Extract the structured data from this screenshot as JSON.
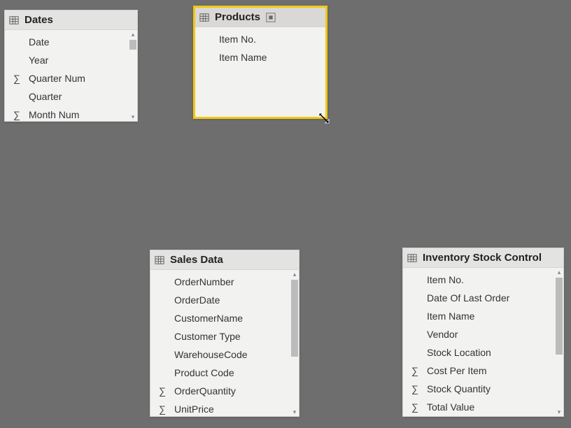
{
  "tables": {
    "dates": {
      "title": "Dates",
      "fields": [
        {
          "name": "Date",
          "sigma": false
        },
        {
          "name": "Year",
          "sigma": false
        },
        {
          "name": "Quarter Num",
          "sigma": true
        },
        {
          "name": "Quarter",
          "sigma": false
        },
        {
          "name": "Month Num",
          "sigma": true
        }
      ]
    },
    "products": {
      "title": "Products",
      "fields": [
        {
          "name": "Item No.",
          "sigma": false
        },
        {
          "name": "Item Name",
          "sigma": false
        }
      ]
    },
    "sales": {
      "title": "Sales Data",
      "fields": [
        {
          "name": "OrderNumber",
          "sigma": false
        },
        {
          "name": "OrderDate",
          "sigma": false
        },
        {
          "name": "CustomerName",
          "sigma": false
        },
        {
          "name": "Customer Type",
          "sigma": false
        },
        {
          "name": "WarehouseCode",
          "sigma": false
        },
        {
          "name": "Product Code",
          "sigma": false
        },
        {
          "name": "OrderQuantity",
          "sigma": true
        },
        {
          "name": "UnitPrice",
          "sigma": true
        }
      ]
    },
    "inventory": {
      "title": "Inventory Stock Control",
      "fields": [
        {
          "name": "Item No.",
          "sigma": false
        },
        {
          "name": "Date Of Last Order",
          "sigma": false
        },
        {
          "name": "Item Name",
          "sigma": false
        },
        {
          "name": "Vendor",
          "sigma": false
        },
        {
          "name": "Stock Location",
          "sigma": false
        },
        {
          "name": "Cost Per Item",
          "sigma": true
        },
        {
          "name": "Stock Quantity",
          "sigma": true
        },
        {
          "name": "Total Value",
          "sigma": true
        }
      ]
    }
  }
}
